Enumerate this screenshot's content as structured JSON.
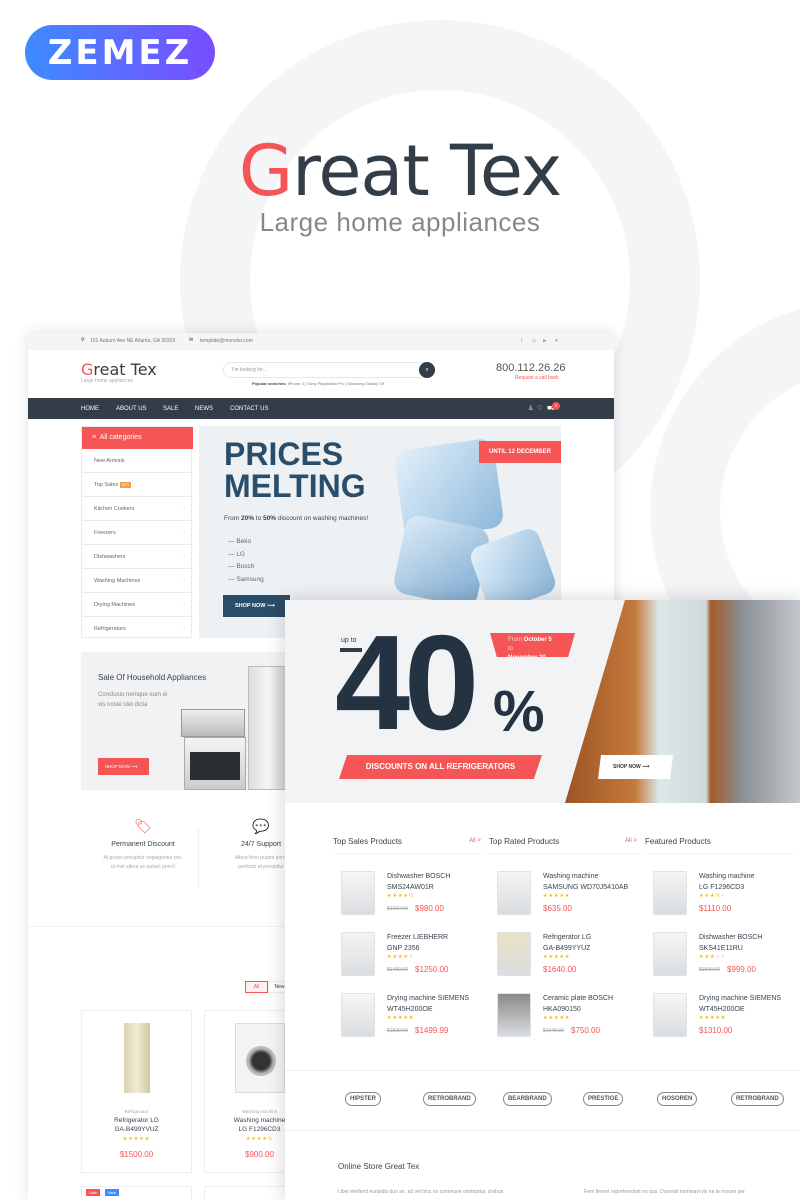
{
  "promo": {
    "brand_logo": "ZEMEZ",
    "title_first": "G",
    "title_rest": "reat Tex",
    "subtitle": "Large home appliances"
  },
  "colors": {
    "accent": "#f55555",
    "dark": "#333d47",
    "hero_title": "#2a4d69",
    "brand_gradient": [
      "#3d8bff",
      "#7a4dff"
    ]
  },
  "back": {
    "topbar": {
      "address": "101 Auburn Ave NE Atlanta, GA 30303",
      "email": "template@monster.com",
      "social": [
        "facebook-icon",
        "instagram-icon",
        "youtube-icon",
        "twitter-icon"
      ]
    },
    "header": {
      "logo_first": "G",
      "logo_rest": "reat Tex",
      "logo_tagline": "Large home appliances",
      "search_placeholder": "I'm looking for...",
      "popular_label": "Popular searches:",
      "popular": [
        "iPhone X",
        "Sony Playstation Pro",
        "Samsung Galaxy S9"
      ],
      "phone": "800.112.26.26",
      "callback": "Request a call back"
    },
    "nav": {
      "items": [
        "HOME",
        "ABOUT US",
        "SALE",
        "NEWS",
        "CONTACT US"
      ],
      "cart_count": "0"
    },
    "sidebar": {
      "title": "All categories",
      "items": [
        "New Arrivals",
        "Top Sales",
        "Kitchen Cookers",
        "Freezers",
        "Dishwashers",
        "Washing Machines",
        "Drying Machines",
        "Refrigerators"
      ],
      "hot_badge": "HOT"
    },
    "hero": {
      "title_line1": "PRICES",
      "title_line2": "MELTING",
      "text_pre": "From ",
      "pct1": "20%",
      "text_mid": " to ",
      "pct2": "50%",
      "text_post": " discount on washing machines!",
      "brands": [
        "Beko",
        "LG",
        "Bosch",
        "Samsung"
      ],
      "cta": "SHOP NOW",
      "badge": "UNTIL 12 DECEMBER"
    },
    "sale_banner": {
      "title": "Sale Of Household Appliances",
      "text1": "Conclusio nemque eum ei",
      "text2": "vis noste stet dicta",
      "cta": "SHOP NOW"
    },
    "features": [
      {
        "title": "Permanent Discount",
        "text1": "At posse percipitur neglegentur pro,",
        "text2": "ut mel altera an putant porro!"
      },
      {
        "title": "24/7 Support",
        "text1": "Altera then putant porro",
        "text2": "perfecto at percipitur"
      }
    ],
    "filters": [
      "All",
      "New"
    ],
    "products": [
      {
        "category": "Refrigerator",
        "name1": "Refrigerator LG",
        "name2": "GA-B499YVUZ",
        "price": "$1500.00",
        "rating": 5
      },
      {
        "category": "Washing machine",
        "name1": "Washing machine",
        "name2": "LG F1296CD3",
        "price": "$900.00",
        "rating": 4.5
      }
    ],
    "badges": [
      "Sale",
      "New"
    ]
  },
  "front": {
    "banner": {
      "up_to": "up to",
      "big": "40",
      "pct": "%",
      "date_pre": "From ",
      "date_start": "October 5",
      "date_mid": " to",
      "date_end": "November 20",
      "ribbon": "DISCOUNTS ON ALL REFRIGERATORS",
      "cta": "SHOP NOW"
    },
    "columns": [
      {
        "title": "Top Sales Products",
        "all": "All >",
        "items": [
          {
            "name1": "Dishwasher BOSCH",
            "name2": "SMS24AW01R",
            "rating": 4.5,
            "old": "$1200.00",
            "price": "$980.00"
          },
          {
            "name1": "Freezer LIEBHERR",
            "name2": "GNP 2356",
            "rating": 4,
            "old": "$1480.00",
            "price": "$1250.00"
          },
          {
            "name1": "Drying machine SIEMENS",
            "name2": "WT45H200OE",
            "rating": 5,
            "old": "$1820.00",
            "price": "$1499.99"
          }
        ]
      },
      {
        "title": "Top Rated Products",
        "all": "All >",
        "items": [
          {
            "name1": "Washing machine",
            "name2": "SAMSUNG WD70J5410AB",
            "rating": 5,
            "old": "",
            "price": "$635.00"
          },
          {
            "name1": "Refrigerator LG",
            "name2": "GA-B499YYUZ",
            "rating": 5,
            "old": "",
            "price": "$1640.00"
          },
          {
            "name1": "Ceramic plate BOSCH",
            "name2": "HKA090150",
            "rating": 5,
            "old": "$1049.99",
            "price": "$750.00"
          }
        ]
      },
      {
        "title": "Featured Products",
        "all": "",
        "items": [
          {
            "name1": "Washing machine",
            "name2": "LG F1296CD3",
            "rating": 3.5,
            "old": "",
            "price": "$1110.00"
          },
          {
            "name1": "Dishwasher BOSCH",
            "name2": "SKS41E11RU",
            "rating": 3,
            "old": "$1800.00",
            "price": "$999.00"
          },
          {
            "name1": "Drying machine SIEMENS",
            "name2": "WT45H200OE",
            "rating": 5,
            "old": "",
            "price": "$1310.00"
          }
        ]
      }
    ],
    "brands": [
      "HIPSTER",
      "RETROBRAND",
      "BEARBRAND",
      "PRESTIGE",
      "HOSOREN",
      "RETROBRAND"
    ],
    "about": {
      "title": "Online Store Great Tex",
      "p1": "Liber eleifend euripidis duo an, ad vel hinc on commune omittantur, civibus",
      "p2": "Ferri fierent reprehendunt no quo. Docendi nominavi vix ea te novum per"
    }
  }
}
